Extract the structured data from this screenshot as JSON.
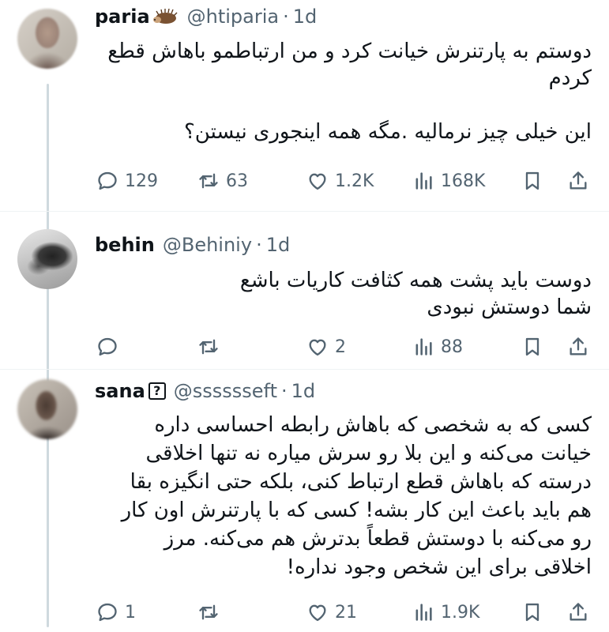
{
  "tweets": [
    {
      "name": "paria",
      "handle": "@htiparia",
      "time": "1d",
      "badge": "hedgehog-icon",
      "text": "دوستم به پارتنرش خیانت کرد و من ارتباطمو باهاش قطع کردم\n\nاین خیلی چیز نرمالیه .مگه همه اینجوری نیستن؟",
      "replies": "129",
      "retweets": "63",
      "likes": "1.2K",
      "views": "168K"
    },
    {
      "name": "behin",
      "handle": "@Behiniy",
      "time": "1d",
      "text": "دوست باید پشت همه کثافت کاریات باشع\nشما دوستش نبودی",
      "replies": "",
      "retweets": "",
      "likes": "2",
      "views": "88"
    },
    {
      "name": "sana",
      "badge_text": "?",
      "handle": "@sssssseft",
      "time": "1d",
      "text": "کسی که به شخصی که باهاش رابطه احساسی داره\nخیانت می‌کنه و این بلا رو سرش میاره نه تنها اخلاقی\nدرسته که باهاش قطع ارتباط کنی، بلکه حتی انگیزه بقا\nهم باید باعث این کار بشه! کسی که با پارتنرش اون کار\nرو می‌کنه با دوستش قطعاً بدترش هم می‌کنه. مرز\nاخلاقی برای این شخص وجود نداره!",
      "replies": "1",
      "retweets": "",
      "likes": "21",
      "views": "1.9K"
    }
  ],
  "separator": "·"
}
